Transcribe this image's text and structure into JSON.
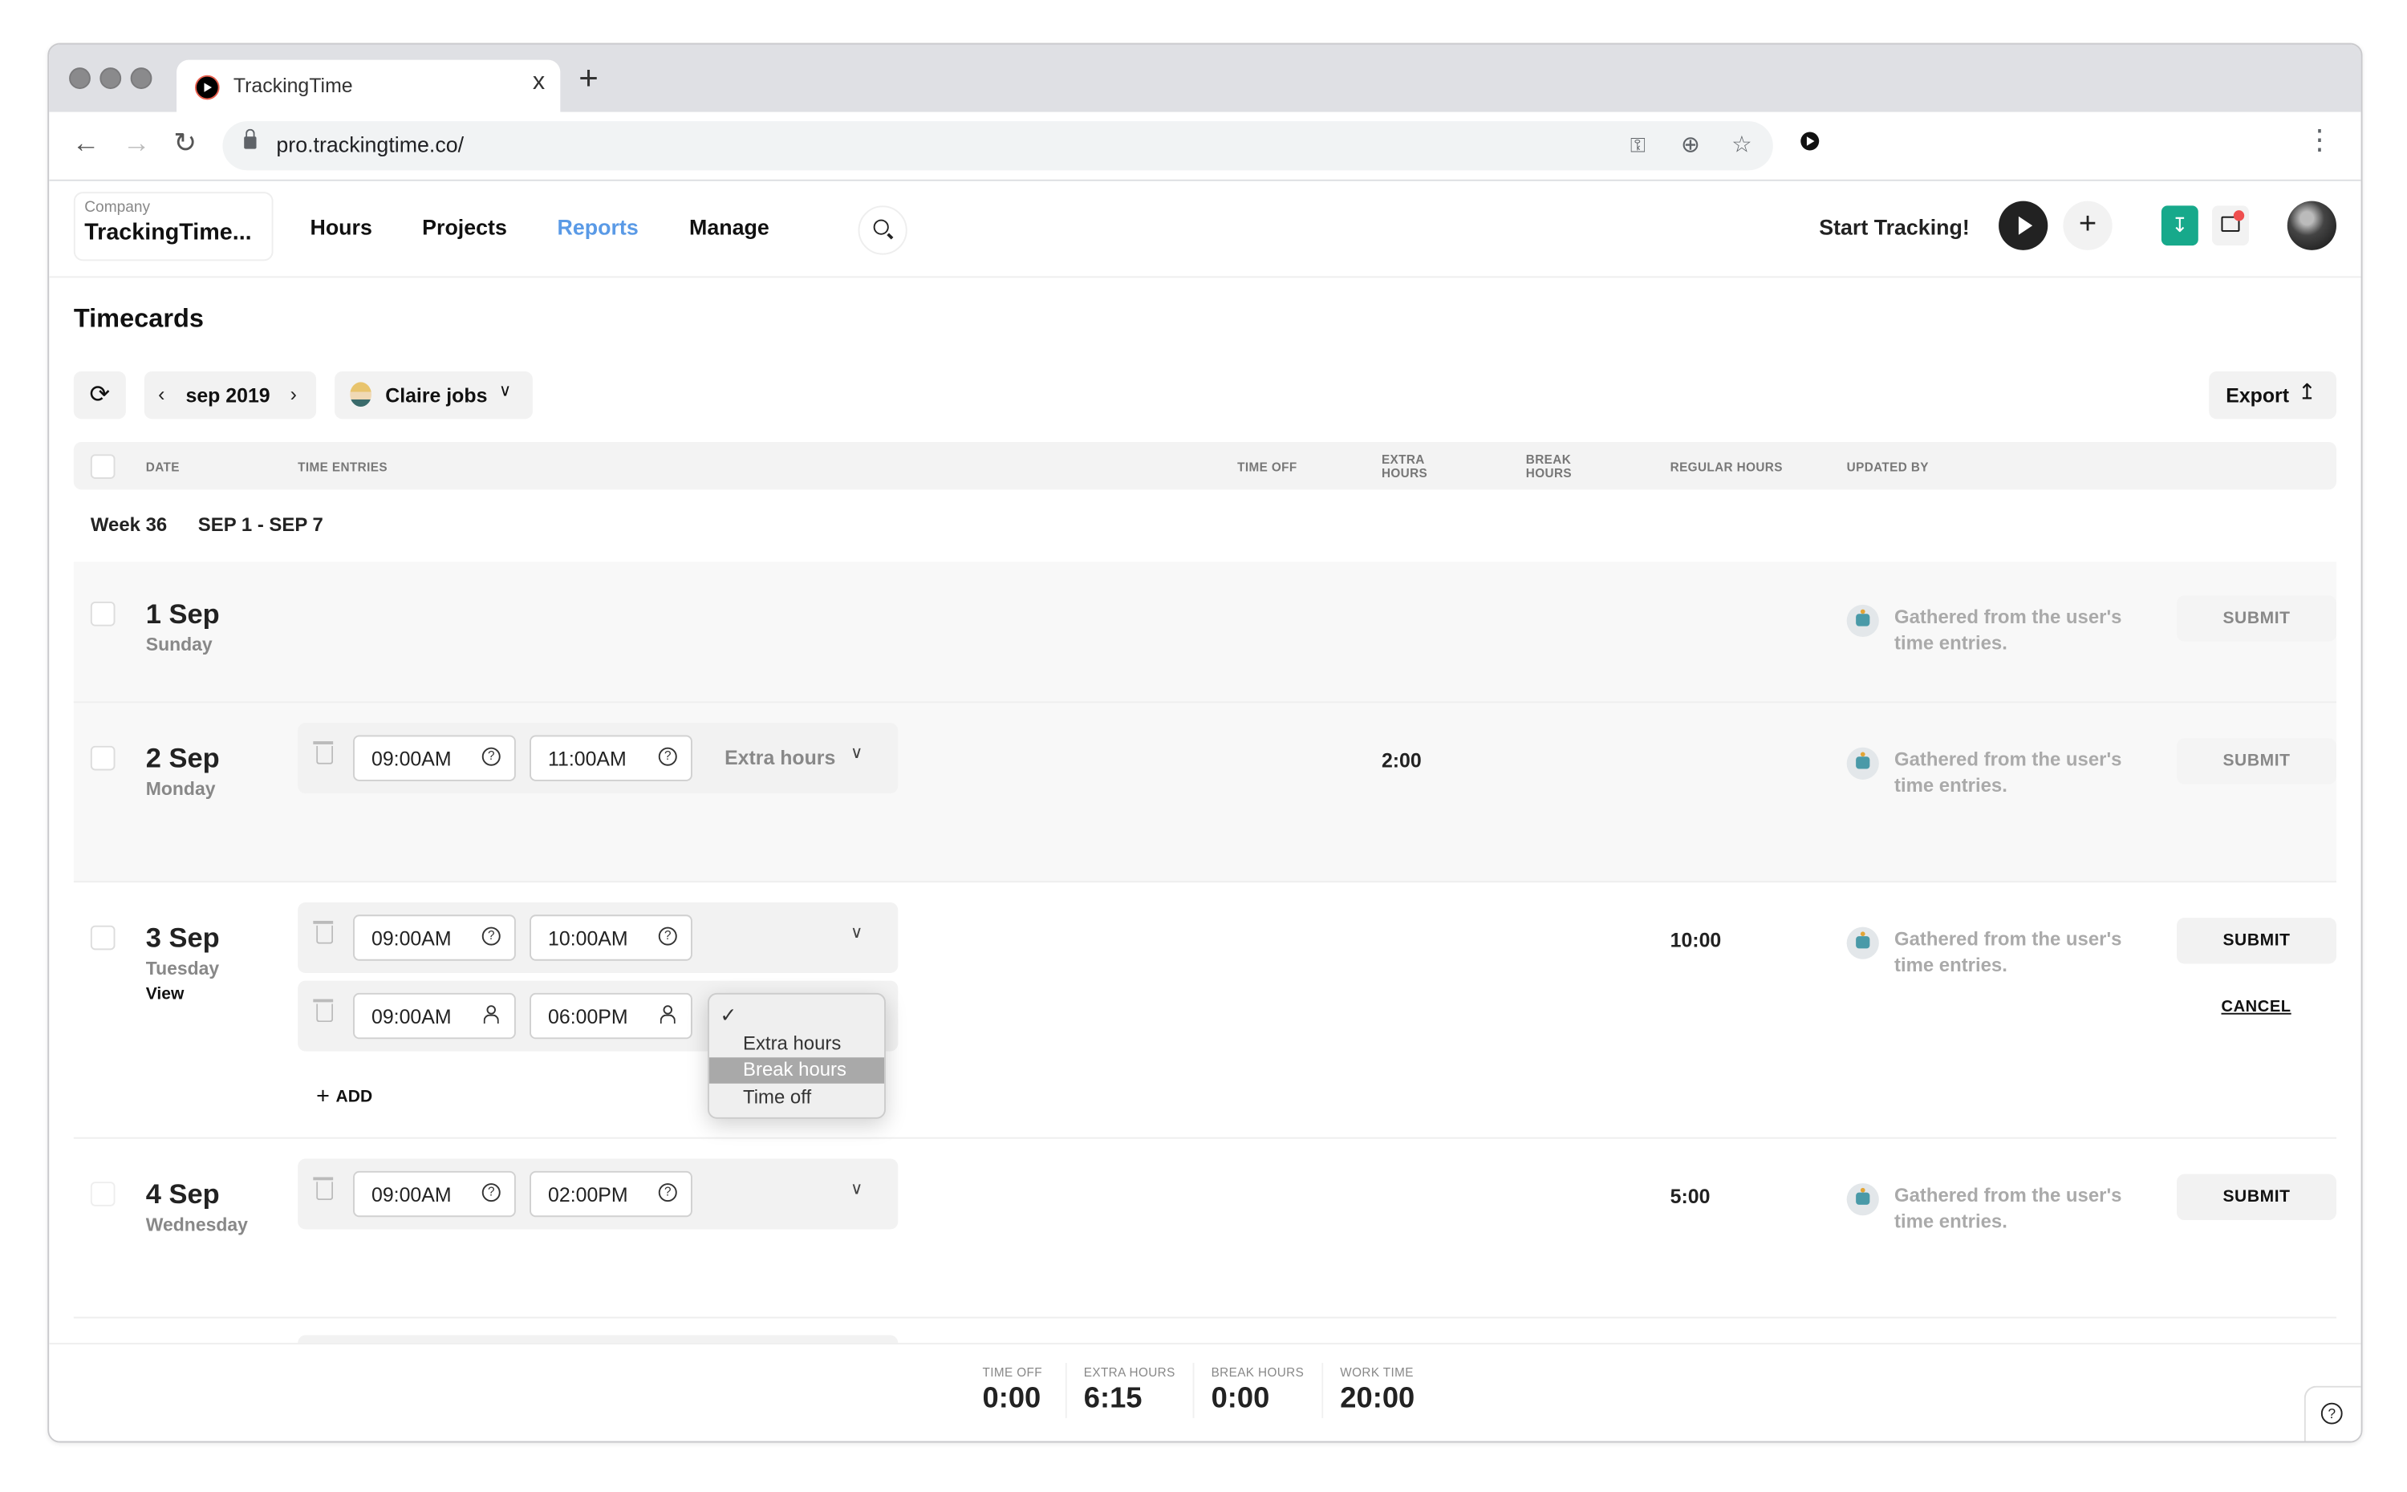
{
  "browser": {
    "tab_title": "TrackingTime",
    "url": "pro.trackingtime.co/",
    "new_tab_glyph": "+",
    "close_glyph": "x",
    "icons": [
      "back-icon",
      "forward-icon",
      "reload-icon",
      "lock-icon",
      "key-icon",
      "add-circle-icon",
      "star-icon",
      "extension-icon",
      "menu-dots-icon"
    ]
  },
  "header": {
    "company_label": "Company",
    "company_name": "TrackingTime...",
    "nav": [
      {
        "label": "Hours",
        "active": false
      },
      {
        "label": "Projects",
        "active": false
      },
      {
        "label": "Reports",
        "active": true
      },
      {
        "label": "Manage",
        "active": false
      }
    ],
    "start_tracking": "Start Tracking!",
    "accent_color": "#5a9ae6",
    "download_color": "#17a98b",
    "notification_color": "#ef4f4f"
  },
  "page": {
    "title": "Timecards",
    "month": "sep 2019",
    "user_filter": "Claire jobs",
    "export_label": "Export"
  },
  "table": {
    "columns": {
      "date": "DATE",
      "time_entries": "TIME ENTRIES",
      "time_off": "TIME OFF",
      "extra_hours_1": "EXTRA",
      "extra_hours_2": "HOURS",
      "break_hours_1": "BREAK",
      "break_hours_2": "HOURS",
      "regular_hours": "REGULAR HOURS",
      "updated_by": "UPDATED BY"
    },
    "week": {
      "label": "Week 36",
      "range": "SEP 1 - SEP 7"
    },
    "updated_note": "Gathered from the user's time entries.",
    "submit_label": "SUBMIT",
    "cancel_label": "CANCEL",
    "view_label": "View",
    "add_label": "ADD",
    "rows": [
      {
        "day": "1 Sep",
        "weekday": "Sunday",
        "entries": [],
        "extra_hours": "",
        "regular_hours": "",
        "submit_enabled": false
      },
      {
        "day": "2 Sep",
        "weekday": "Monday",
        "entries": [
          {
            "start": "09:00AM",
            "end": "11:00AM",
            "type": "Extra hours"
          }
        ],
        "extra_hours": "2:00",
        "regular_hours": "",
        "submit_enabled": false
      },
      {
        "day": "3 Sep",
        "weekday": "Tuesday",
        "entries": [
          {
            "start": "09:00AM",
            "end": "10:00AM",
            "type": ""
          },
          {
            "start": "09:00AM",
            "end": "06:00PM",
            "type": ""
          }
        ],
        "extra_hours": "",
        "regular_hours": "10:00",
        "submit_enabled": true
      },
      {
        "day": "4 Sep",
        "weekday": "Wednesday",
        "entries": [
          {
            "start": "09:00AM",
            "end": "02:00PM",
            "type": ""
          }
        ],
        "extra_hours": "",
        "regular_hours": "5:00",
        "submit_enabled": true
      }
    ]
  },
  "type_dropdown": {
    "selected": "",
    "options": [
      "",
      "Extra hours",
      "Break hours",
      "Time off"
    ],
    "highlighted": "Break hours"
  },
  "summary": [
    {
      "label": "TIME OFF",
      "value": "0:00"
    },
    {
      "label": "EXTRA HOURS",
      "value": "6:15"
    },
    {
      "label": "BREAK HOURS",
      "value": "0:00"
    },
    {
      "label": "WORK TIME",
      "value": "20:00"
    }
  ]
}
